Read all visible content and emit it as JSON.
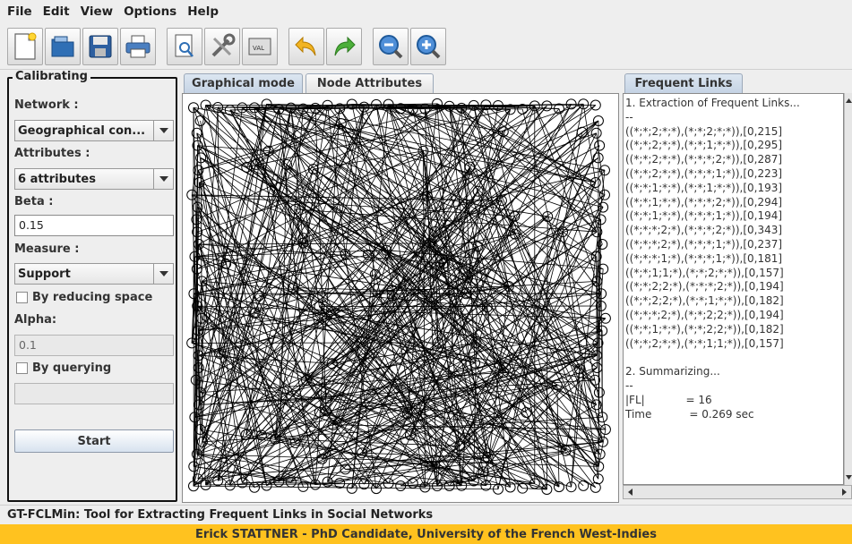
{
  "menu": [
    "File",
    "Edit",
    "View",
    "Options",
    "Help"
  ],
  "toolbar": {
    "buttons": [
      "new-file-icon",
      "open-folder-icon",
      "save-icon",
      "print-icon",
      "preview-icon",
      "tools-icon",
      "export-icon",
      "undo-icon",
      "redo-icon",
      "zoom-out-icon",
      "zoom-in-icon"
    ]
  },
  "calibrating": {
    "title": "Calibrating",
    "network_label": "Network :",
    "network_value": "Geographical con...",
    "attributes_label": "Attributes :",
    "attributes_value": "6 attributes",
    "beta_label": "Beta :",
    "beta_value": "0.15",
    "measure_label": "Measure :",
    "measure_value": "Support",
    "reducing_space_label": "By reducing space",
    "alpha_label": "Alpha:",
    "alpha_value": "0.1",
    "querying_label": "By querying",
    "query_value": "",
    "start_label": "Start"
  },
  "tabs": {
    "graphical": "Graphical mode",
    "node_attributes": "Node Attributes",
    "frequent_links": "Frequent Links"
  },
  "output": {
    "lines": [
      "1. Extraction of Frequent Links...",
      "--",
      "((*;*;2;*;*),(*;*;2;*;*)),[0,215]",
      "((*;*;2;*;*),(*;*;1;*;*)),[0,295]",
      "((*;*;2;*;*),(*;*;*;2;*)),[0,287]",
      "((*;*;2;*;*),(*;*;*;1;*)),[0,223]",
      "((*;*;1;*;*),(*;*;1;*;*)),[0,193]",
      "((*;*;1;*;*),(*;*;*;2;*)),[0,294]",
      "((*;*;1;*;*),(*;*;*;1;*)),[0,194]",
      "((*;*;*;2;*),(*;*;*;2;*)),[0,343]",
      "((*;*;*;2;*),(*;*;*;1;*)),[0,237]",
      "((*;*;*;1;*),(*;*;*;1;*)),[0,181]",
      "((*;*;1;1;*),(*;*;2;*;*)),[0,157]",
      "((*;*;2;2;*),(*;*;*;2;*)),[0,194]",
      "((*;*;2;2;*),(*;*;1;*;*)),[0,182]",
      "((*;*;*;2;*),(*;*;2;2;*)),[0,194]",
      "((*;*;1;*;*),(*;*;2;2;*)),[0,182]",
      "((*;*;2;*;*),(*;*;1;1;*)),[0,157]",
      "",
      "2. Summarizing...",
      "--",
      "|FL|            = 16",
      "Time           = 0.269 sec"
    ]
  },
  "status": "GT-FCLMin: Tool for Extracting Frequent Links in Social Networks",
  "footer": "Erick STATTNER - PhD Candidate, University of the French West-Indies",
  "colors": {
    "footer_bg": "#ffc21f",
    "active_tab": "#c5d3e4",
    "node_stroke": "#000000"
  }
}
